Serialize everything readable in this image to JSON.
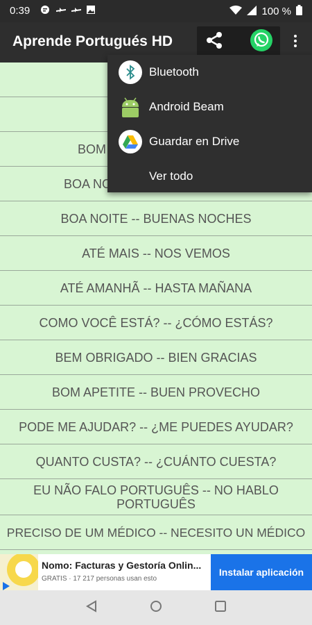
{
  "status_bar": {
    "time": "0:39",
    "battery": "100 %",
    "icons": [
      "chat-icon",
      "plane-icon",
      "plane-icon",
      "photo-icon",
      "wifi-icon",
      "signal-icon",
      "battery-icon"
    ]
  },
  "app_bar": {
    "title": "Aprende Portugués HD",
    "share_icon": "share-icon",
    "whatsapp_icon": "whatsapp-icon",
    "overflow_icon": "more-vert-icon"
  },
  "share_menu": {
    "items": [
      {
        "label": "Bluetooth",
        "icon": "bluetooth-icon"
      },
      {
        "label": "Android Beam",
        "icon": "android-icon"
      },
      {
        "label": "Guardar en Drive",
        "icon": "drive-icon"
      },
      {
        "label": "Ver todo",
        "icon": ""
      }
    ]
  },
  "phrases": [
    "",
    "",
    "BOM",
    "BOA NO",
    "BOA NOITE -- BUENAS NOCHES",
    "ATÉ MAIS -- NOS VEMOS",
    "ATÉ AMANHÃ -- HASTA MAÑANA",
    "COMO VOCÊ ESTÁ? -- ¿CÓMO ESTÁS?",
    "BEM OBRIGADO -- BIEN GRACIAS",
    "BOM APETITE -- BUEN PROVECHO",
    "PODE ME AJUDAR? -- ¿ME PUEDES AYUDAR?",
    "QUANTO CUSTA? -- ¿CUÁNTO CUESTA?",
    "EU NÃO FALO PORTUGUÊS -- NO HABLO PORTUGUÊS",
    "PRECISO DE UM MÉDICO -- NECESITO UN MÉDICO"
  ],
  "ad": {
    "name": "Nomo: Facturas y Gestoría Onlin...",
    "sub": "GRATIS · 17 217 personas usan esto",
    "install_label": "Instalar aplicación"
  },
  "colors": {
    "list_bg": "#d8f5d3",
    "appbar_bg": "#2e2e2e",
    "menu_bg": "#2f2f2f",
    "install_bg": "#1a73e8",
    "whatsapp": "#25d366"
  }
}
